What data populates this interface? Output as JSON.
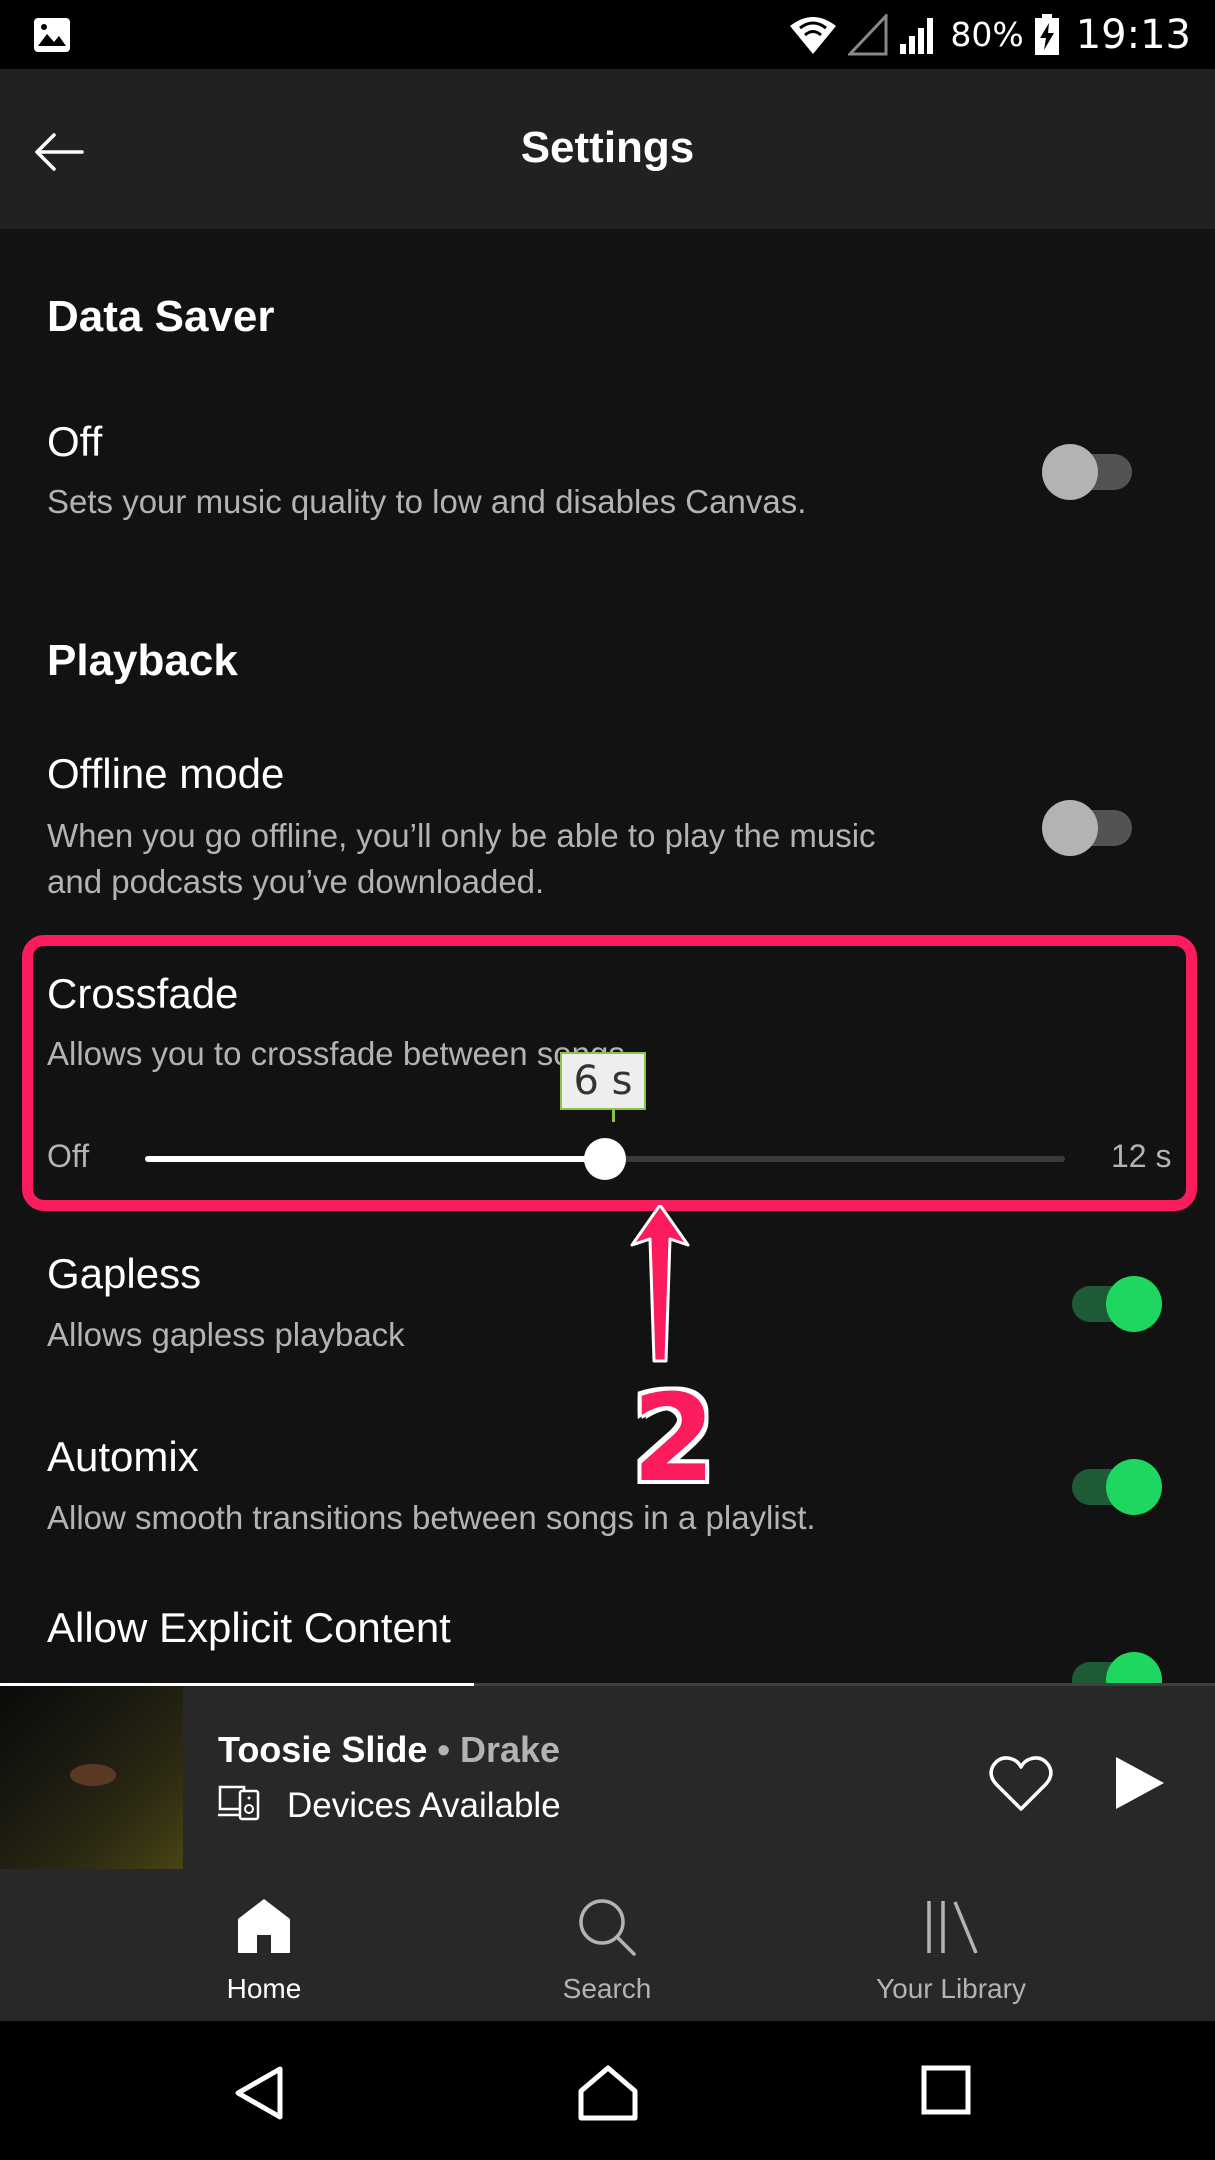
{
  "status_bar": {
    "battery": "80%",
    "time": "19:13"
  },
  "app_bar": {
    "title": "Settings"
  },
  "sections": {
    "data_saver": {
      "title": "Data Saver",
      "row": {
        "title": "Off",
        "description": "Sets your music quality to low and disables Canvas.",
        "enabled": false
      }
    },
    "playback": {
      "title": "Playback",
      "offline": {
        "title": "Offline mode",
        "description_line1": "When you go offline, you’ll only be able to play the music",
        "description_line2": "and podcasts you’ve downloaded.",
        "enabled": false
      },
      "crossfade": {
        "title": "Crossfade",
        "description": "Allows you to crossfade between songs",
        "min_label": "Off",
        "max_label": "12 s",
        "value_label": "6 s",
        "value_seconds": 6,
        "max_seconds": 12
      },
      "gapless": {
        "title": "Gapless",
        "description": "Allows gapless playback",
        "enabled": true
      },
      "automix": {
        "title": "Automix",
        "description": "Allow smooth transitions between songs in a playlist.",
        "enabled": true
      },
      "explicit": {
        "title": "Allow Explicit Content",
        "enabled": true
      }
    }
  },
  "annotation": {
    "number": "2",
    "color": "#fa1c5c"
  },
  "player": {
    "song": "Toosie Slide",
    "separator": " • ",
    "artist": "Drake",
    "devices_label": "Devices Available",
    "progress_fraction": 0.39
  },
  "bottom_nav": {
    "home": "Home",
    "search": "Search",
    "library": "Your Library"
  },
  "colors": {
    "background": "#121212",
    "accent": "#1ed760",
    "annotation": "#fa1c5c"
  }
}
